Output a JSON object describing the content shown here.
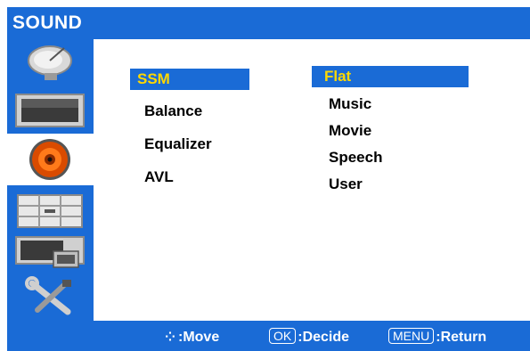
{
  "header": {
    "title": "SOUND"
  },
  "sidebar": {
    "items": [
      {
        "icon": "satellite-dish-icon",
        "active": false
      },
      {
        "icon": "tv-screen-icon",
        "active": false
      },
      {
        "icon": "speaker-icon",
        "active": true
      },
      {
        "icon": "channel-grid-icon",
        "active": false
      },
      {
        "icon": "pip-screen-icon",
        "active": false
      },
      {
        "icon": "tools-icon",
        "active": false
      }
    ]
  },
  "menu": {
    "items": [
      {
        "label": "SSM",
        "selected": true
      },
      {
        "label": "Balance",
        "selected": false
      },
      {
        "label": "Equalizer",
        "selected": false
      },
      {
        "label": "AVL",
        "selected": false
      }
    ]
  },
  "options": {
    "items": [
      {
        "label": "Flat",
        "selected": true
      },
      {
        "label": "Music",
        "selected": false
      },
      {
        "label": "Movie",
        "selected": false
      },
      {
        "label": "Speech",
        "selected": false
      },
      {
        "label": "User",
        "selected": false
      }
    ]
  },
  "footer": {
    "move_label": ":Move",
    "ok_key": "OK",
    "decide_label": ":Decide",
    "menu_key": "MENU",
    "return_label": ":Return"
  },
  "colors": {
    "accent": "#1a6bd6",
    "highlight_text": "#ffd800"
  }
}
